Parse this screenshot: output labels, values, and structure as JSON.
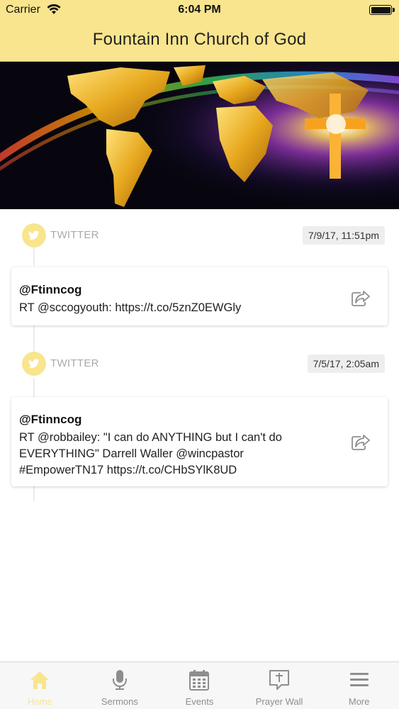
{
  "status_bar": {
    "carrier": "Carrier",
    "time": "6:04 PM"
  },
  "header": {
    "title": "Fountain Inn Church of God"
  },
  "hero": {
    "image": "world-map-with-glowing-cross"
  },
  "feed": {
    "items": [
      {
        "source": "TWITTER",
        "date": "7/9/17, 11:51pm",
        "author": "@Ftinncog",
        "text": "RT @sccogyouth: https://t.co/5znZ0EWGly"
      },
      {
        "source": "TWITTER",
        "date": "7/5/17, 2:05am",
        "author": "@Ftinncog",
        "text": "RT @robbailey: \"I can do ANYTHING but I can't do EVERYTHING\" Darrell Waller @wincpastor #EmpowerTN17 https://t.co/CHbSYlK8UD"
      }
    ]
  },
  "tab_bar": {
    "tabs": [
      {
        "label": "Home",
        "icon": "home-icon",
        "active": true
      },
      {
        "label": "Sermons",
        "icon": "microphone-icon",
        "active": false
      },
      {
        "label": "Events",
        "icon": "calendar-icon",
        "active": false
      },
      {
        "label": "Prayer Wall",
        "icon": "prayer-cross-icon",
        "active": false
      },
      {
        "label": "More",
        "icon": "menu-icon",
        "active": false
      }
    ]
  },
  "colors": {
    "accent": "#f9e58e",
    "inactive_tab": "#8e8e8e",
    "timeline": "#ececec"
  }
}
